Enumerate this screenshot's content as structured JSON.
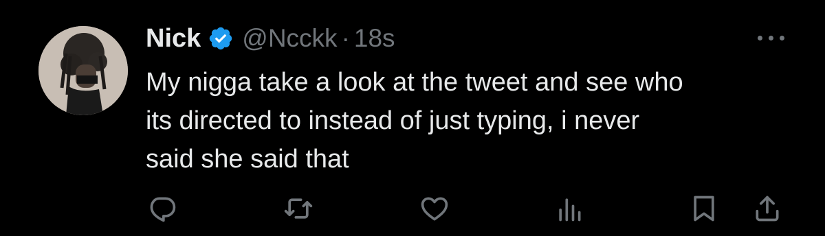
{
  "tweet": {
    "author_name": "Nick",
    "handle": "@Ncckk",
    "separator": "·",
    "time": "18s",
    "verified": true,
    "text_lines": [
      "My nigga take a look at the tweet and see who",
      "its directed to instead of just typing,  i never",
      "said she said that"
    ]
  },
  "colors": {
    "background": "#000000",
    "primary_text": "#e7e9ea",
    "secondary_text": "#71767b",
    "verified_badge": "#1d9bf0"
  },
  "icons": {
    "more": "more-icon",
    "reply": "reply-icon",
    "retweet": "retweet-icon",
    "like": "like-icon",
    "views": "views-icon",
    "bookmark": "bookmark-icon",
    "share": "share-icon"
  }
}
